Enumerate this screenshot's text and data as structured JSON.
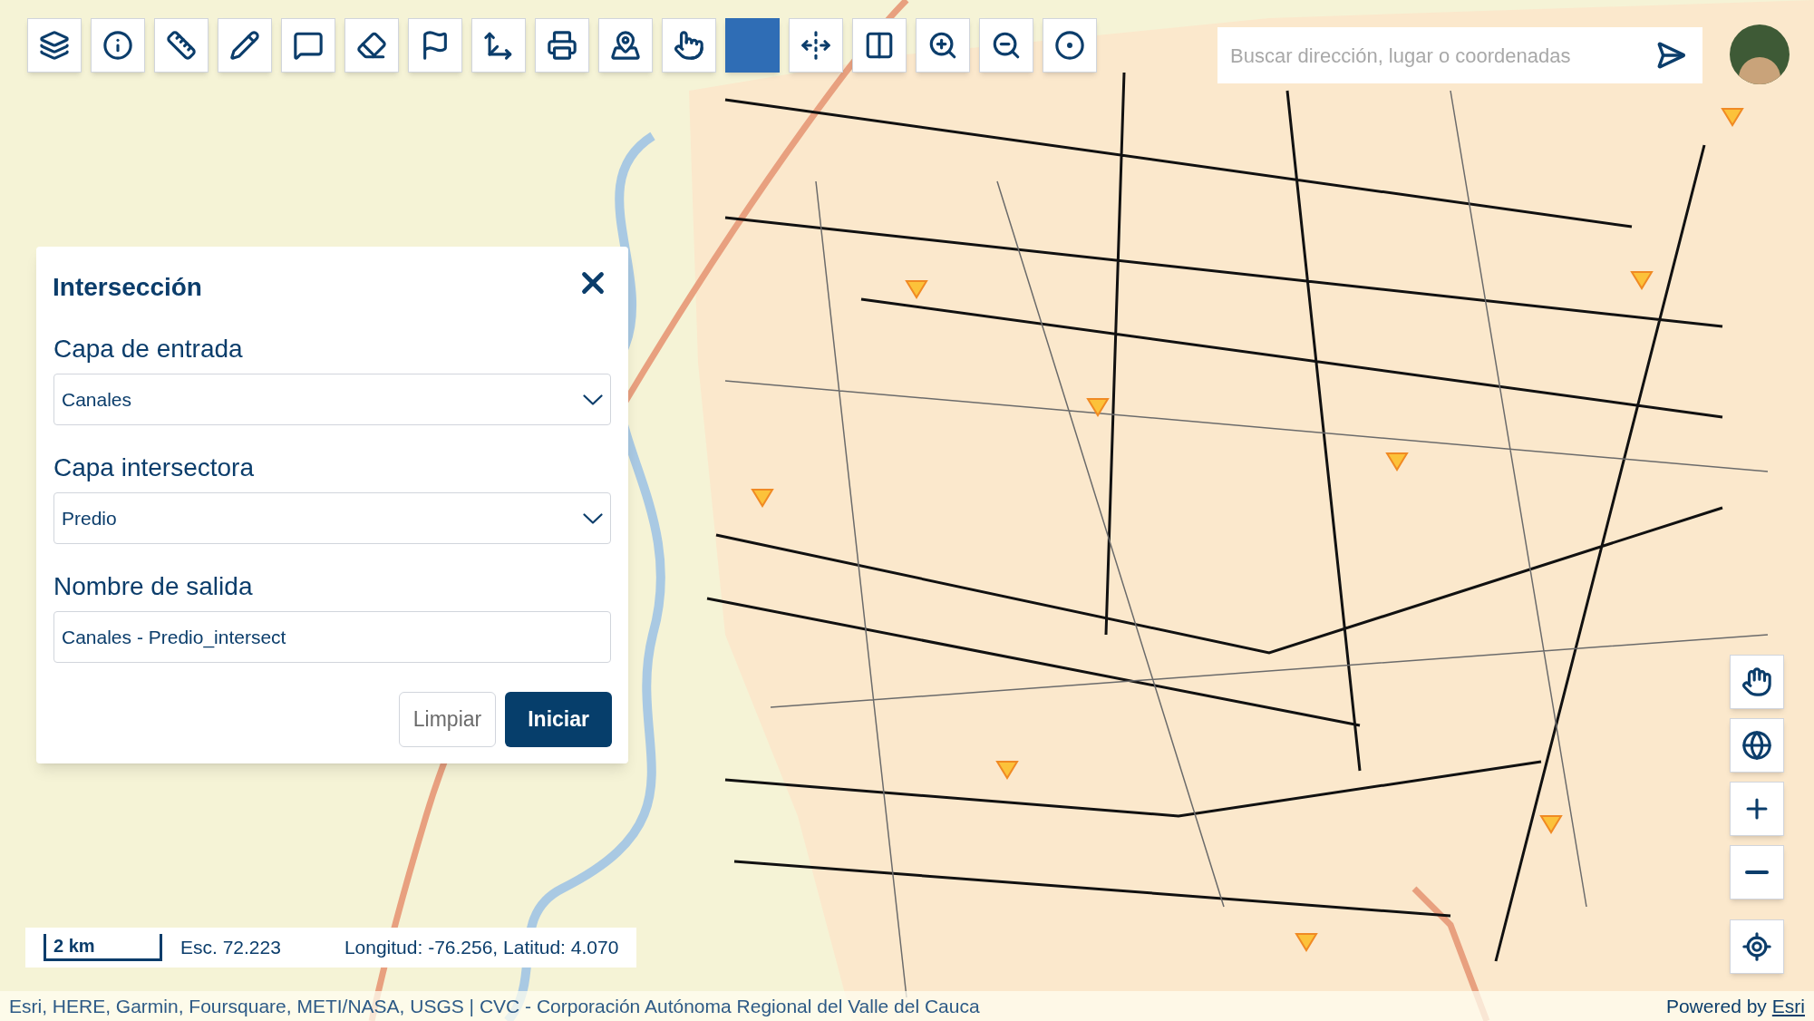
{
  "toolbar": {
    "tools": [
      {
        "kind": "layers",
        "selected": false
      },
      {
        "kind": "info",
        "selected": false
      },
      {
        "kind": "ruler",
        "selected": false
      },
      {
        "kind": "pencil",
        "selected": false
      },
      {
        "kind": "comment",
        "selected": false
      },
      {
        "kind": "eraser",
        "selected": false
      },
      {
        "kind": "flag",
        "selected": false
      },
      {
        "kind": "axes",
        "selected": false
      },
      {
        "kind": "printer",
        "selected": false
      },
      {
        "kind": "map-pin",
        "selected": false
      },
      {
        "kind": "pointer",
        "selected": false
      },
      {
        "kind": "blank",
        "selected": true
      },
      {
        "kind": "swipe",
        "selected": false
      },
      {
        "kind": "split",
        "selected": false
      },
      {
        "kind": "zoom-in",
        "selected": false
      },
      {
        "kind": "zoom-out",
        "selected": false
      },
      {
        "kind": "coordinates",
        "selected": false
      }
    ]
  },
  "search": {
    "placeholder": "Buscar dirección, lugar o coordenadas"
  },
  "panel": {
    "title": "Intersección",
    "fields": [
      {
        "label": "Capa de entrada",
        "kind": "select",
        "value": "Canales"
      },
      {
        "label": "Capa intersectora",
        "kind": "select",
        "value": "Predio"
      },
      {
        "label": "Nombre de salida",
        "kind": "text",
        "value": "Canales - Predio_intersect"
      }
    ],
    "buttons": [
      {
        "label": "Limpiar",
        "kind": "secondary"
      },
      {
        "label": "Iniciar",
        "kind": "primary"
      }
    ]
  },
  "map_controls": [
    {
      "kind": "pan"
    },
    {
      "kind": "basemap"
    },
    {
      "kind": "zoom-in"
    },
    {
      "kind": "zoom-out"
    },
    {
      "kind": "locate"
    }
  ],
  "scale_bar": {
    "distance": "2 km",
    "scale": "Esc. 72.223",
    "coordinates": "Longitud: -76.256, Latitud: 4.070"
  },
  "attribution": {
    "sources": "Esri, HERE, Garmin, Foursquare, METI/NASA, USGS | CVC - Corporación Autónoma Regional del Valle del Cauca",
    "powered_by": "Powered by",
    "link": "Esri"
  }
}
